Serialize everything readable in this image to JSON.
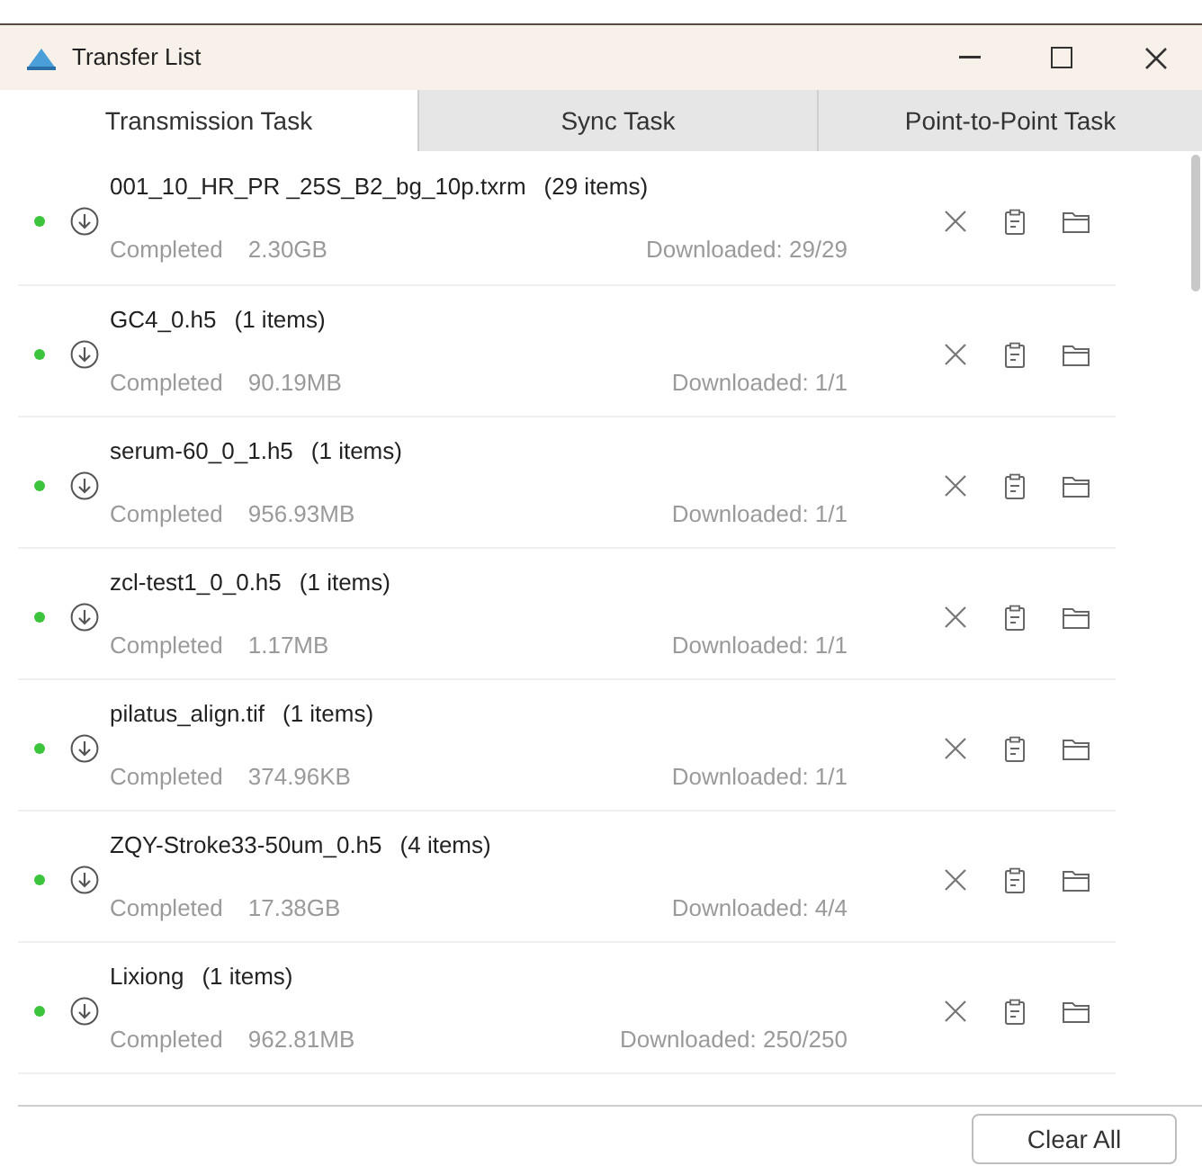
{
  "window": {
    "title": "Transfer List"
  },
  "tabs": [
    {
      "label": "Transmission Task",
      "selected": true
    },
    {
      "label": "Sync Task",
      "selected": false
    },
    {
      "label": "Point-to-Point Task",
      "selected": false
    }
  ],
  "tasks": [
    {
      "name": "001_10_HR_PR _25S_B2_bg_10p.txrm",
      "count": "(29 items)",
      "status": "Completed",
      "size": "2.30GB",
      "progress": "Downloaded: 29/29",
      "color": "#3cc43c"
    },
    {
      "name": "GC4_0.h5",
      "count": "(1 items)",
      "status": "Completed",
      "size": "90.19MB",
      "progress": "Downloaded: 1/1",
      "color": "#3cc43c"
    },
    {
      "name": "serum-60_0_1.h5",
      "count": "(1 items)",
      "status": "Completed",
      "size": "956.93MB",
      "progress": "Downloaded: 1/1",
      "color": "#3cc43c"
    },
    {
      "name": "zcl-test1_0_0.h5",
      "count": "(1 items)",
      "status": "Completed",
      "size": "1.17MB",
      "progress": "Downloaded: 1/1",
      "color": "#3cc43c"
    },
    {
      "name": "pilatus_align.tif",
      "count": "(1 items)",
      "status": "Completed",
      "size": "374.96KB",
      "progress": "Downloaded: 1/1",
      "color": "#3cc43c"
    },
    {
      "name": "ZQY-Stroke33-50um_0.h5",
      "count": "(4 items)",
      "status": "Completed",
      "size": "17.38GB",
      "progress": "Downloaded: 4/4",
      "color": "#3cc43c"
    },
    {
      "name": "Lixiong",
      "count": "(1 items)",
      "status": "Completed",
      "size": "962.81MB",
      "progress": "Downloaded: 250/250",
      "color": "#3cc43c"
    }
  ],
  "footer": {
    "button": "Clear All"
  }
}
